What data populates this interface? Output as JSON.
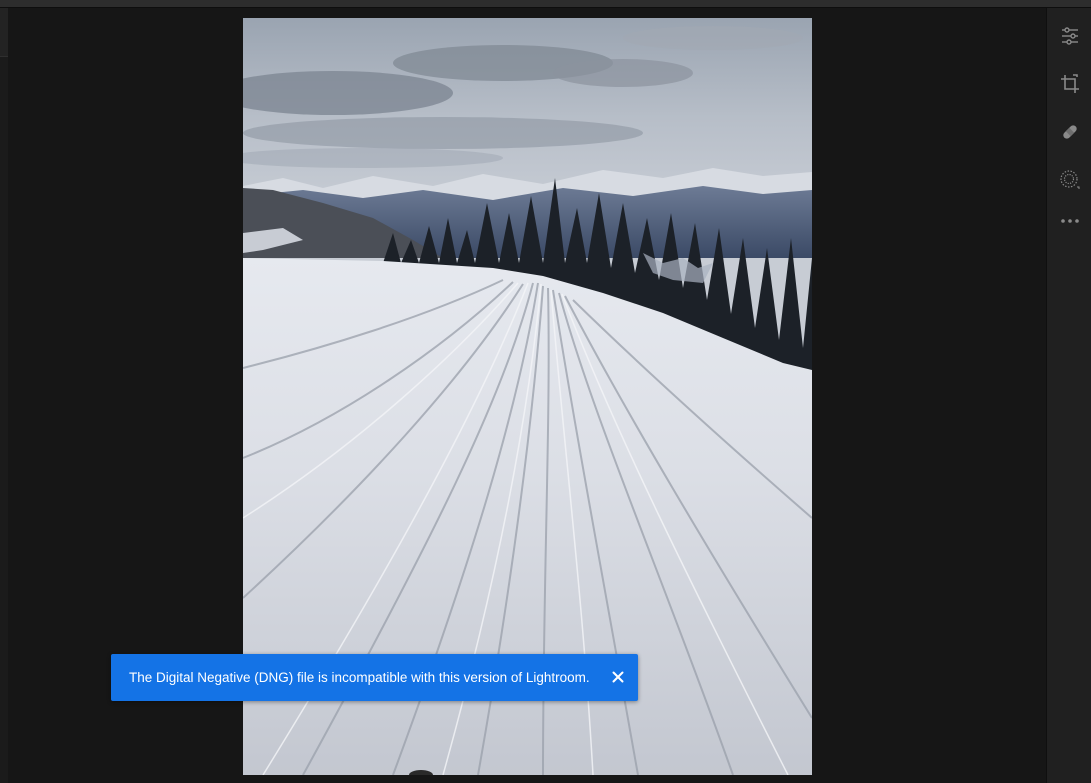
{
  "editor": {
    "tools": [
      {
        "name": "edit-sliders-icon",
        "label": "Edit"
      },
      {
        "name": "crop-icon",
        "label": "Crop & Rotate"
      },
      {
        "name": "healing-icon",
        "label": "Healing"
      },
      {
        "name": "masking-icon",
        "label": "Masking"
      },
      {
        "name": "more-icon",
        "label": "More"
      }
    ],
    "icon_color": "#8a8a8a"
  },
  "photo": {
    "subject": "snowy ski slope with tracks, pine trees and mountains"
  },
  "toast": {
    "message": "The Digital Negative (DNG) file is incompatible with this version of Lightroom.",
    "close_icon": "close-icon",
    "color": "#1473e6"
  }
}
